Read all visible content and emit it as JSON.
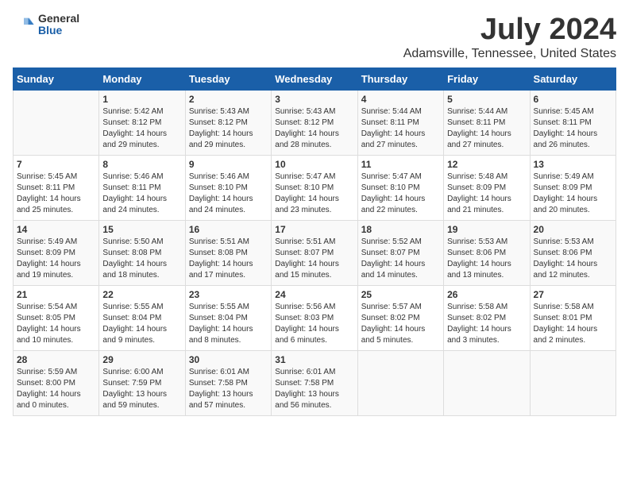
{
  "header": {
    "logo_general": "General",
    "logo_blue": "Blue",
    "title": "July 2024",
    "subtitle": "Adamsville, Tennessee, United States"
  },
  "days_of_week": [
    "Sunday",
    "Monday",
    "Tuesday",
    "Wednesday",
    "Thursday",
    "Friday",
    "Saturday"
  ],
  "weeks": [
    [
      {
        "day": "",
        "content": ""
      },
      {
        "day": "1",
        "content": "Sunrise: 5:42 AM\nSunset: 8:12 PM\nDaylight: 14 hours\nand 29 minutes."
      },
      {
        "day": "2",
        "content": "Sunrise: 5:43 AM\nSunset: 8:12 PM\nDaylight: 14 hours\nand 29 minutes."
      },
      {
        "day": "3",
        "content": "Sunrise: 5:43 AM\nSunset: 8:12 PM\nDaylight: 14 hours\nand 28 minutes."
      },
      {
        "day": "4",
        "content": "Sunrise: 5:44 AM\nSunset: 8:11 PM\nDaylight: 14 hours\nand 27 minutes."
      },
      {
        "day": "5",
        "content": "Sunrise: 5:44 AM\nSunset: 8:11 PM\nDaylight: 14 hours\nand 27 minutes."
      },
      {
        "day": "6",
        "content": "Sunrise: 5:45 AM\nSunset: 8:11 PM\nDaylight: 14 hours\nand 26 minutes."
      }
    ],
    [
      {
        "day": "7",
        "content": "Sunrise: 5:45 AM\nSunset: 8:11 PM\nDaylight: 14 hours\nand 25 minutes."
      },
      {
        "day": "8",
        "content": "Sunrise: 5:46 AM\nSunset: 8:11 PM\nDaylight: 14 hours\nand 24 minutes."
      },
      {
        "day": "9",
        "content": "Sunrise: 5:46 AM\nSunset: 8:10 PM\nDaylight: 14 hours\nand 24 minutes."
      },
      {
        "day": "10",
        "content": "Sunrise: 5:47 AM\nSunset: 8:10 PM\nDaylight: 14 hours\nand 23 minutes."
      },
      {
        "day": "11",
        "content": "Sunrise: 5:47 AM\nSunset: 8:10 PM\nDaylight: 14 hours\nand 22 minutes."
      },
      {
        "day": "12",
        "content": "Sunrise: 5:48 AM\nSunset: 8:09 PM\nDaylight: 14 hours\nand 21 minutes."
      },
      {
        "day": "13",
        "content": "Sunrise: 5:49 AM\nSunset: 8:09 PM\nDaylight: 14 hours\nand 20 minutes."
      }
    ],
    [
      {
        "day": "14",
        "content": "Sunrise: 5:49 AM\nSunset: 8:09 PM\nDaylight: 14 hours\nand 19 minutes."
      },
      {
        "day": "15",
        "content": "Sunrise: 5:50 AM\nSunset: 8:08 PM\nDaylight: 14 hours\nand 18 minutes."
      },
      {
        "day": "16",
        "content": "Sunrise: 5:51 AM\nSunset: 8:08 PM\nDaylight: 14 hours\nand 17 minutes."
      },
      {
        "day": "17",
        "content": "Sunrise: 5:51 AM\nSunset: 8:07 PM\nDaylight: 14 hours\nand 15 minutes."
      },
      {
        "day": "18",
        "content": "Sunrise: 5:52 AM\nSunset: 8:07 PM\nDaylight: 14 hours\nand 14 minutes."
      },
      {
        "day": "19",
        "content": "Sunrise: 5:53 AM\nSunset: 8:06 PM\nDaylight: 14 hours\nand 13 minutes."
      },
      {
        "day": "20",
        "content": "Sunrise: 5:53 AM\nSunset: 8:06 PM\nDaylight: 14 hours\nand 12 minutes."
      }
    ],
    [
      {
        "day": "21",
        "content": "Sunrise: 5:54 AM\nSunset: 8:05 PM\nDaylight: 14 hours\nand 10 minutes."
      },
      {
        "day": "22",
        "content": "Sunrise: 5:55 AM\nSunset: 8:04 PM\nDaylight: 14 hours\nand 9 minutes."
      },
      {
        "day": "23",
        "content": "Sunrise: 5:55 AM\nSunset: 8:04 PM\nDaylight: 14 hours\nand 8 minutes."
      },
      {
        "day": "24",
        "content": "Sunrise: 5:56 AM\nSunset: 8:03 PM\nDaylight: 14 hours\nand 6 minutes."
      },
      {
        "day": "25",
        "content": "Sunrise: 5:57 AM\nSunset: 8:02 PM\nDaylight: 14 hours\nand 5 minutes."
      },
      {
        "day": "26",
        "content": "Sunrise: 5:58 AM\nSunset: 8:02 PM\nDaylight: 14 hours\nand 3 minutes."
      },
      {
        "day": "27",
        "content": "Sunrise: 5:58 AM\nSunset: 8:01 PM\nDaylight: 14 hours\nand 2 minutes."
      }
    ],
    [
      {
        "day": "28",
        "content": "Sunrise: 5:59 AM\nSunset: 8:00 PM\nDaylight: 14 hours\nand 0 minutes."
      },
      {
        "day": "29",
        "content": "Sunrise: 6:00 AM\nSunset: 7:59 PM\nDaylight: 13 hours\nand 59 minutes."
      },
      {
        "day": "30",
        "content": "Sunrise: 6:01 AM\nSunset: 7:58 PM\nDaylight: 13 hours\nand 57 minutes."
      },
      {
        "day": "31",
        "content": "Sunrise: 6:01 AM\nSunset: 7:58 PM\nDaylight: 13 hours\nand 56 minutes."
      },
      {
        "day": "",
        "content": ""
      },
      {
        "day": "",
        "content": ""
      },
      {
        "day": "",
        "content": ""
      }
    ]
  ]
}
